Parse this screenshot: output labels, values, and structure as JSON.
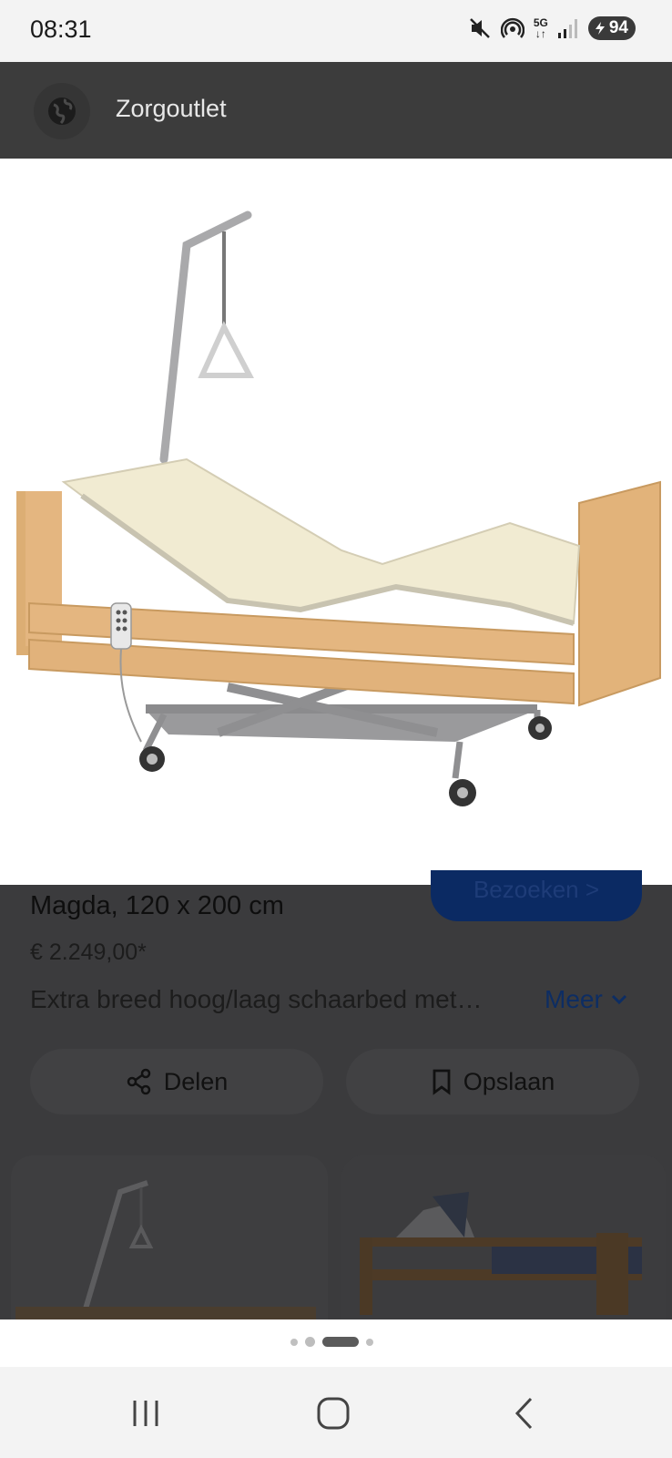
{
  "status_bar": {
    "time": "08:31",
    "battery": "94",
    "network": "5G"
  },
  "header": {
    "site_name": "Zorgoutlet"
  },
  "product": {
    "title": "Magda, 120 x 200 cm",
    "visit_button": "Bezoeken >",
    "price": "€ 2.249,00*",
    "description": "Extra breed hoog/laag schaarbed met…",
    "more_label": "Meer"
  },
  "actions": {
    "share_label": "Delen",
    "save_label": "Opslaan"
  },
  "pager": {
    "count": 4,
    "active_index": 2
  },
  "colors": {
    "link": "#0d2d63",
    "overlay": "#3b3b3d",
    "wood": "#e2b37a"
  },
  "icons": [
    "mute-icon",
    "hotspot-icon",
    "signal-icon",
    "battery-icon",
    "globe-icon",
    "share-icon",
    "bookmark-icon",
    "chevron-down-icon",
    "recents-icon",
    "home-icon",
    "back-icon"
  ]
}
